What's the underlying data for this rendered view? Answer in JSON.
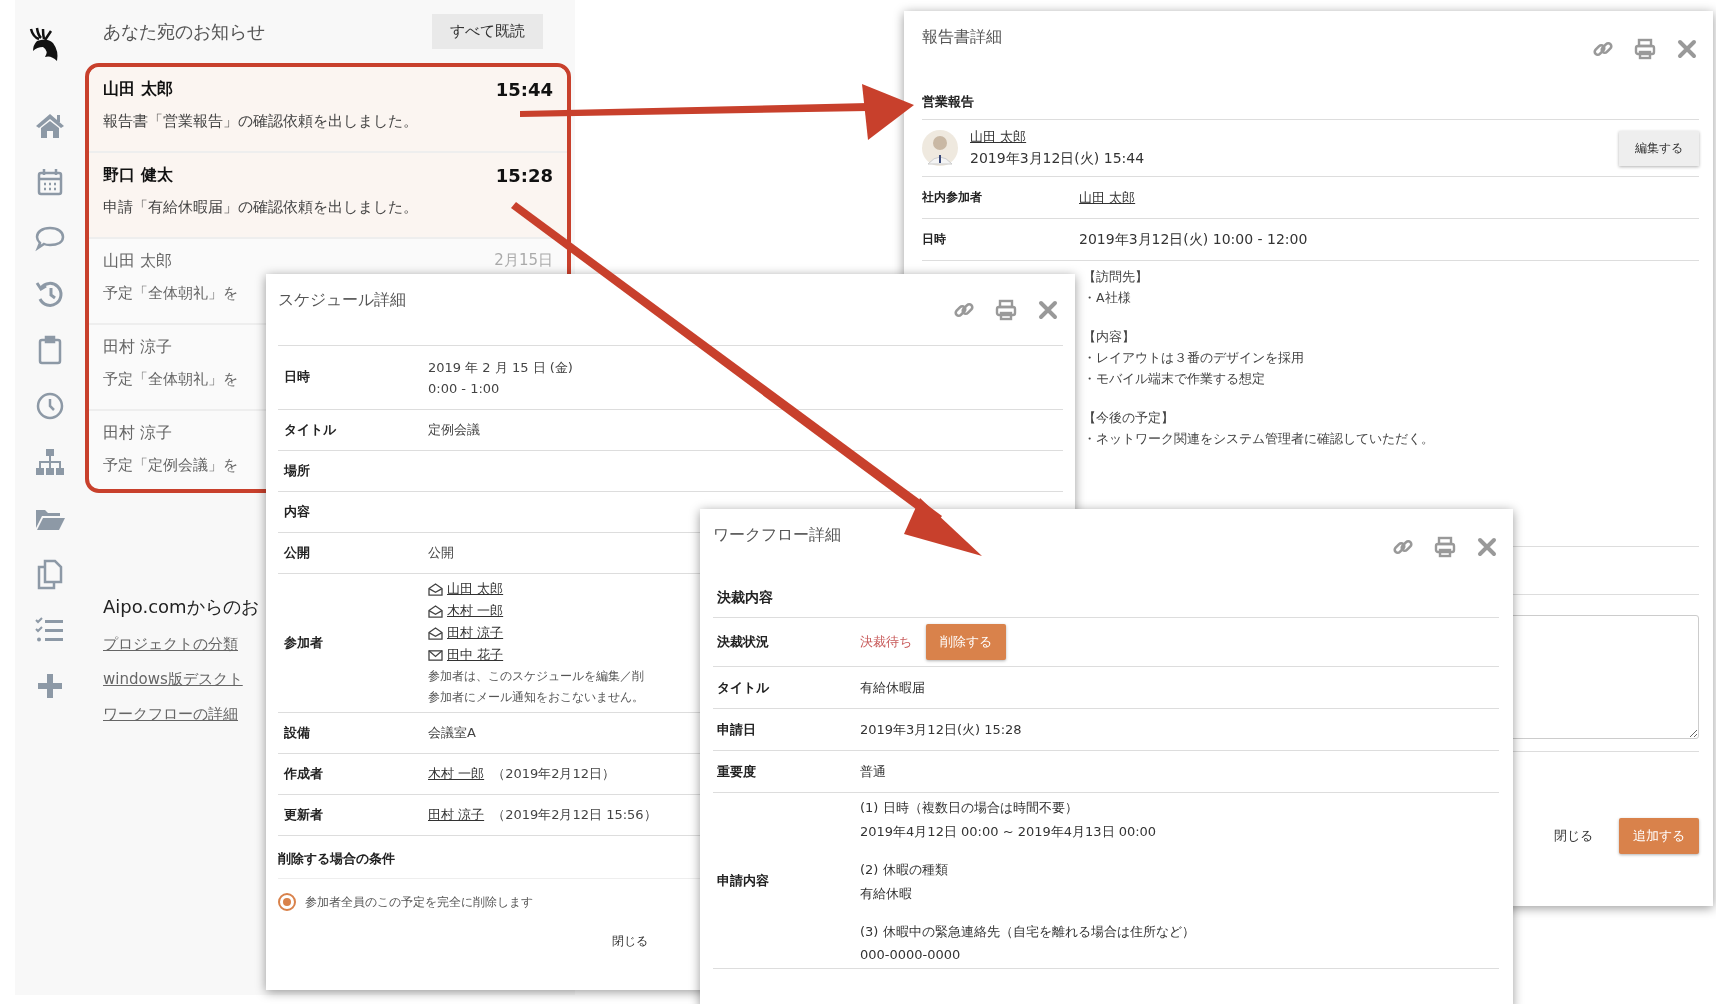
{
  "notifications": {
    "title": "あなた宛のお知らせ",
    "mark_all_read": "すべて既読",
    "items": [
      {
        "name": "山田 太郎",
        "time": "15:44",
        "message": "報告書「営業報告」の確認依頼を出しました。",
        "unread": true
      },
      {
        "name": "野口 健太",
        "time": "15:28",
        "message": "申請「有給休暇届」の確認依頼を出しました。",
        "unread": true
      },
      {
        "name": "山田 太郎",
        "time": "2月15日",
        "message": "予定「全体朝礼」を",
        "unread": false
      },
      {
        "name": "田村 涼子",
        "message": "予定「全体朝礼」を",
        "unread": false
      },
      {
        "name": "田村 涼子",
        "message": "予定「定例会議」を",
        "unread": false
      }
    ]
  },
  "news": {
    "title": "Aipo.comからのお",
    "links": [
      "プロジェクトの分類",
      "windows版デスクト",
      "ワークフローの詳細"
    ]
  },
  "report": {
    "title": "報告書詳細",
    "subject": "営業報告",
    "author": {
      "name": "山田 太郎",
      "datetime": "2019年3月12日(火) 15:44"
    },
    "edit": "編集する",
    "rows": [
      {
        "kind": "link",
        "label": "社内参加者",
        "value": "山田 太郎"
      },
      {
        "kind": "text",
        "label": "日時",
        "value": "2019年3月12日(火) 10:00 - 12:00"
      }
    ],
    "body": [
      [
        "【訪問先】",
        "・A社様"
      ],
      [
        "【内容】",
        "・レイアウトは３番のデザインを採用",
        "・モバイル端末で作業する想定"
      ],
      [
        "【今後の予定】",
        "・ネットワーク関連をシステム管理者に確認していただく。"
      ]
    ],
    "close": "閉じる",
    "add": "追加する"
  },
  "schedule": {
    "title": "スケジュール詳細",
    "rows": [
      {
        "kind": "text",
        "label": "日時",
        "lines": [
          "2019 年 2 月 15 日 (金)",
          "0:00 - 1:00"
        ]
      },
      {
        "kind": "text",
        "label": "タイトル",
        "lines": [
          "定例会議"
        ]
      },
      {
        "kind": "text",
        "label": "場所"
      },
      {
        "kind": "text",
        "label": "内容"
      },
      {
        "kind": "text",
        "label": "公開",
        "lines": [
          "公開"
        ]
      },
      {
        "kind": "participants",
        "label": "参加者",
        "people": [
          {
            "name": "山田 太郎",
            "mail_read": true
          },
          {
            "name": "木村 一郎",
            "mail_read": true
          },
          {
            "name": "田村 涼子",
            "mail_read": true
          },
          {
            "name": "田中 花子",
            "mail_read": false
          }
        ],
        "notes": [
          "参加者は、このスケジュールを編集／削",
          "参加者にメール通知をおこないません。"
        ]
      },
      {
        "kind": "text",
        "label": "設備",
        "lines": [
          "会議室A"
        ]
      },
      {
        "kind": "person",
        "label": "作成者",
        "person": "木村 一郎",
        "note": "（2019年2月12日）"
      },
      {
        "kind": "person",
        "label": "更新者",
        "person": "田村 涼子",
        "note": "（2019年2月12日 15:56）"
      }
    ],
    "delete_section": {
      "title": "削除する場合の条件",
      "options": [
        {
          "label": "参加者全員のこの予定を完全に削除します",
          "selected": true
        }
      ]
    },
    "close": "閉じる"
  },
  "workflow": {
    "title": "ワークフロー詳細",
    "section": "決裁内容",
    "status": {
      "label": "決裁状況",
      "value": "決裁待ち",
      "delete": "削除する"
    },
    "rows": [
      {
        "label": "タイトル",
        "groups": [
          [
            "有給休暇届"
          ]
        ]
      },
      {
        "label": "申請日",
        "groups": [
          [
            "2019年3月12日(火) 15:28"
          ]
        ]
      },
      {
        "label": "重要度",
        "groups": [
          [
            "普通"
          ]
        ]
      },
      {
        "label": "申請内容",
        "groups": [
          [
            "(1) 日時（複数日の場合は時間不要）",
            "2019年4月12日 00:00 ~ 2019年4月13日 00:00"
          ],
          [
            "(2) 休暇の種類",
            "有給休暇"
          ],
          [
            "(3) 休暇中の緊急連絡先（自宅を離れる場合は住所など）",
            "000-0000-0000"
          ]
        ]
      }
    ]
  }
}
